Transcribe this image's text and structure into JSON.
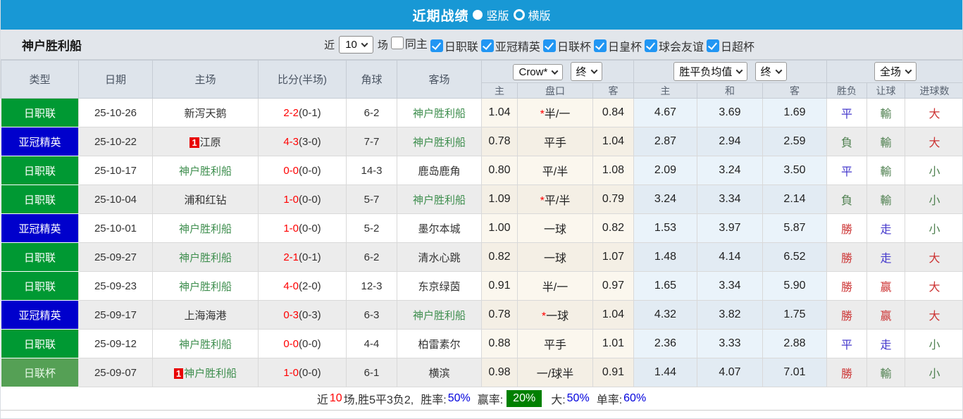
{
  "colors": {
    "titlebar-bg": "#1898d5",
    "checkbox-blue": "#2196f3",
    "league-green": "#009933",
    "acl-blue": "#0000cc",
    "cup-green": "#55a055",
    "team-green": "#3e8e4e",
    "score-red": "#ff0000",
    "res-red": "#cc3333",
    "res-green": "#4f8050",
    "res-blue": "#4438cc",
    "pct-blue": "#0000dd",
    "summary-green": "#008000"
  },
  "titlebar": {
    "title": "近期战绩",
    "radio_vertical": "竖版",
    "radio_horizontal": "横版"
  },
  "filterbar": {
    "team": "神户胜利船",
    "recent_label": "近",
    "recent_count": "10",
    "matches_label": "场",
    "checkboxes": [
      {
        "label": "同主",
        "checked": false
      },
      {
        "label": "日职联",
        "checked": true
      },
      {
        "label": "亚冠精英",
        "checked": true
      },
      {
        "label": "日联杯",
        "checked": true
      },
      {
        "label": "日皇杯",
        "checked": true
      },
      {
        "label": "球会友谊",
        "checked": true
      },
      {
        "label": "日超杯",
        "checked": true
      }
    ]
  },
  "table": {
    "headers": {
      "type": "类型",
      "date": "日期",
      "home": "主场",
      "score": "比分(半场)",
      "corner": "角球",
      "away": "客场",
      "odds_source_select": "Crow*",
      "odds_time_select": "终",
      "avg_select": "胜平负均值",
      "avg_time_select": "终",
      "result_select": "全场",
      "sub": {
        "home": "主",
        "handicap": "盘口",
        "away": "客",
        "avg_home": "主",
        "avg_draw": "和",
        "avg_away": "客",
        "wdl": "胜负",
        "let": "让球",
        "goals": "进球数"
      }
    },
    "rows": [
      {
        "type": "日职联",
        "type_style": "league",
        "date": "25-10-26",
        "home": "新泻天鹅",
        "home_badge": "",
        "home_highlight": false,
        "score": "2-2",
        "half": "(0-1)",
        "corner": "6-2",
        "away": "神户胜利船",
        "away_highlight": true,
        "odds_home": "1.04",
        "handicap": "半/一",
        "handicap_star": true,
        "odds_away": "0.84",
        "avg_home": "4.67",
        "avg_draw": "3.69",
        "avg_away": "1.69",
        "wdl": "平",
        "wdl_color": "blue",
        "let": "輸",
        "let_color": "green",
        "goals": "大",
        "goals_color": "red"
      },
      {
        "type": "亚冠精英",
        "type_style": "acl",
        "date": "25-10-22",
        "home": "江原",
        "home_badge": "1",
        "home_highlight": false,
        "score": "4-3",
        "half": "(3-0)",
        "corner": "7-7",
        "away": "神户胜利船",
        "away_highlight": true,
        "odds_home": "0.78",
        "handicap": "平手",
        "handicap_star": false,
        "odds_away": "1.04",
        "avg_home": "2.87",
        "avg_draw": "2.94",
        "avg_away": "2.59",
        "wdl": "負",
        "wdl_color": "green",
        "let": "輸",
        "let_color": "green",
        "goals": "大",
        "goals_color": "red"
      },
      {
        "type": "日职联",
        "type_style": "league",
        "date": "25-10-17",
        "home": "神户胜利船",
        "home_badge": "",
        "home_highlight": true,
        "score": "0-0",
        "half": "(0-0)",
        "corner": "14-3",
        "away": "鹿岛鹿角",
        "away_highlight": false,
        "odds_home": "0.80",
        "handicap": "平/半",
        "handicap_star": false,
        "odds_away": "1.08",
        "avg_home": "2.09",
        "avg_draw": "3.24",
        "avg_away": "3.50",
        "wdl": "平",
        "wdl_color": "blue",
        "let": "輸",
        "let_color": "green",
        "goals": "小",
        "goals_color": "green"
      },
      {
        "type": "日职联",
        "type_style": "league",
        "date": "25-10-04",
        "home": "浦和红钻",
        "home_badge": "",
        "home_highlight": false,
        "score": "1-0",
        "half": "(0-0)",
        "corner": "5-7",
        "away": "神户胜利船",
        "away_highlight": true,
        "odds_home": "1.09",
        "handicap": "平/半",
        "handicap_star": true,
        "odds_away": "0.79",
        "avg_home": "3.24",
        "avg_draw": "3.34",
        "avg_away": "2.14",
        "wdl": "負",
        "wdl_color": "green",
        "let": "輸",
        "let_color": "green",
        "goals": "小",
        "goals_color": "green"
      },
      {
        "type": "亚冠精英",
        "type_style": "acl",
        "date": "25-10-01",
        "home": "神户胜利船",
        "home_badge": "",
        "home_highlight": true,
        "score": "1-0",
        "half": "(0-0)",
        "corner": "5-2",
        "away": "墨尔本城",
        "away_highlight": false,
        "odds_home": "1.00",
        "handicap": "一球",
        "handicap_star": false,
        "odds_away": "0.82",
        "avg_home": "1.53",
        "avg_draw": "3.97",
        "avg_away": "5.87",
        "wdl": "勝",
        "wdl_color": "red",
        "let": "走",
        "let_color": "blue",
        "goals": "小",
        "goals_color": "green"
      },
      {
        "type": "日职联",
        "type_style": "league",
        "date": "25-09-27",
        "home": "神户胜利船",
        "home_badge": "",
        "home_highlight": true,
        "score": "2-1",
        "half": "(0-1)",
        "corner": "6-2",
        "away": "清水心跳",
        "away_highlight": false,
        "odds_home": "0.82",
        "handicap": "一球",
        "handicap_star": false,
        "odds_away": "1.07",
        "avg_home": "1.48",
        "avg_draw": "4.14",
        "avg_away": "6.52",
        "wdl": "勝",
        "wdl_color": "red",
        "let": "走",
        "let_color": "blue",
        "goals": "大",
        "goals_color": "red"
      },
      {
        "type": "日职联",
        "type_style": "league",
        "date": "25-09-23",
        "home": "神户胜利船",
        "home_badge": "",
        "home_highlight": true,
        "score": "4-0",
        "half": "(2-0)",
        "corner": "12-3",
        "away": "东京绿茵",
        "away_highlight": false,
        "odds_home": "0.91",
        "handicap": "半/一",
        "handicap_star": false,
        "odds_away": "0.97",
        "avg_home": "1.65",
        "avg_draw": "3.34",
        "avg_away": "5.90",
        "wdl": "勝",
        "wdl_color": "red",
        "let": "赢",
        "let_color": "red",
        "goals": "大",
        "goals_color": "red"
      },
      {
        "type": "亚冠精英",
        "type_style": "acl",
        "date": "25-09-17",
        "home": "上海海港",
        "home_badge": "",
        "home_highlight": false,
        "score": "0-3",
        "half": "(0-3)",
        "corner": "6-3",
        "away": "神户胜利船",
        "away_highlight": true,
        "odds_home": "0.78",
        "handicap": "一球",
        "handicap_star": true,
        "odds_away": "1.04",
        "avg_home": "4.32",
        "avg_draw": "3.82",
        "avg_away": "1.75",
        "wdl": "勝",
        "wdl_color": "red",
        "let": "赢",
        "let_color": "red",
        "goals": "大",
        "goals_color": "red"
      },
      {
        "type": "日职联",
        "type_style": "league",
        "date": "25-09-12",
        "home": "神户胜利船",
        "home_badge": "",
        "home_highlight": true,
        "score": "0-0",
        "half": "(0-0)",
        "corner": "4-4",
        "away": "柏雷素尔",
        "away_highlight": false,
        "odds_home": "0.88",
        "handicap": "平手",
        "handicap_star": false,
        "odds_away": "1.01",
        "avg_home": "2.36",
        "avg_draw": "3.33",
        "avg_away": "2.88",
        "wdl": "平",
        "wdl_color": "blue",
        "let": "走",
        "let_color": "blue",
        "goals": "小",
        "goals_color": "green"
      },
      {
        "type": "日联杯",
        "type_style": "cup",
        "date": "25-09-07",
        "home": "神户胜利船",
        "home_badge": "1",
        "home_highlight": true,
        "score": "1-0",
        "half": "(0-0)",
        "corner": "6-1",
        "away": "横滨",
        "away_highlight": false,
        "odds_home": "0.98",
        "handicap": "一/球半",
        "handicap_star": false,
        "odds_away": "0.91",
        "avg_home": "1.44",
        "avg_draw": "4.07",
        "avg_away": "7.01",
        "wdl": "勝",
        "wdl_color": "red",
        "let": "輸",
        "let_color": "green",
        "goals": "小",
        "goals_color": "green"
      }
    ]
  },
  "summary": {
    "prefix": "近",
    "count": "10",
    "record": "场,胜5平3负2,",
    "win_rate_label": "胜率:",
    "win_rate": "50%",
    "profit_label": "赢率:",
    "profit": "20%",
    "big_label": "大:",
    "big": "50%",
    "single_label": "单率:",
    "single": "60%"
  }
}
